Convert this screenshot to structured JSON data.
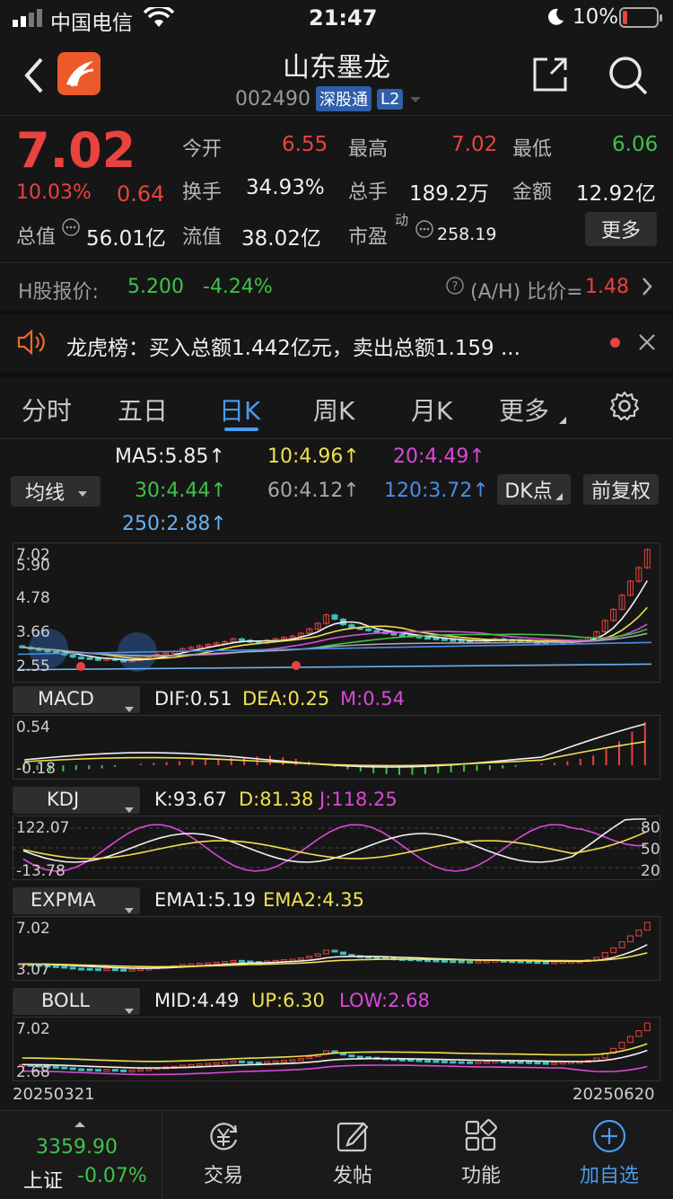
{
  "status_bar": {
    "carrier": "中国电信",
    "time": "21:47",
    "battery": "10%"
  },
  "header": {
    "title": "山东墨龙",
    "code": "002490",
    "badge_market": "深股通",
    "badge_level": "L2"
  },
  "quote": {
    "price": "7.02",
    "change_pct": "10.03%",
    "change": "0.64",
    "open_label": "今开",
    "open": "6.55",
    "high_label": "最高",
    "high": "7.02",
    "low_label": "最低",
    "low": "6.06",
    "turnover_label": "换手",
    "turnover": "34.93%",
    "volume_label": "总手",
    "volume": "189.2万",
    "amount_label": "金额",
    "amount": "12.92亿",
    "mktcap_label": "总值",
    "mktcap": "56.01亿",
    "float_label": "流值",
    "float": "38.02亿",
    "pe_label": "市盈",
    "pe_sup": "动",
    "pe": "258.19",
    "more_button": "更多"
  },
  "hshare": {
    "label": "H股报价:",
    "price": "5.200",
    "change_pct": "-4.24%",
    "ah_label": "(A/H) 比价=",
    "ah_value": "1.48"
  },
  "notice": {
    "text": "龙虎榜：买入总额1.442亿元，卖出总额1.159 ..."
  },
  "tabs": [
    {
      "label": "分时"
    },
    {
      "label": "五日"
    },
    {
      "label": "日K"
    },
    {
      "label": "周K"
    },
    {
      "label": "月K"
    },
    {
      "label": "更多"
    }
  ],
  "ma": {
    "selector": "均线",
    "ma5": "MA5:5.85",
    "ma10": "10:4.96",
    "ma20": "20:4.49",
    "ma30": "30:4.44",
    "ma60": "60:4.12",
    "ma120": "120:3.72",
    "ma250": "250:2.88",
    "dk_button": "DK点",
    "fq_button": "前复权",
    "arrow": "↑"
  },
  "colors": {
    "up": "#e8433f",
    "down": "#3fc24a",
    "accent": "#3b8fe8",
    "yellow": "#f0e050",
    "magenta": "#d84ad8"
  },
  "chart_data": [
    {
      "type": "candlestick",
      "panel": "main",
      "ylim": [
        2.55,
        7.02
      ],
      "y_tick_labels": [
        "7.02",
        "5.90",
        "4.78",
        "3.66",
        "2.55"
      ],
      "x_start": "20250321",
      "x_end": "20250620",
      "closes": [
        3.55,
        3.5,
        3.45,
        3.4,
        3.35,
        3.28,
        3.2,
        3.18,
        3.15,
        3.1,
        3.15,
        3.1,
        3.05,
        3.1,
        3.15,
        3.2,
        3.3,
        3.35,
        3.4,
        3.5,
        3.55,
        3.6,
        3.65,
        3.7,
        3.75,
        3.85,
        3.8,
        3.75,
        3.7,
        3.8,
        3.85,
        3.9,
        3.95,
        4.05,
        4.2,
        4.4,
        4.7,
        4.55,
        4.35,
        4.25,
        4.2,
        4.15,
        4.1,
        4.05,
        4.0,
        3.98,
        3.95,
        3.9,
        3.88,
        3.85,
        3.82,
        3.8,
        3.78,
        3.75,
        3.78,
        3.8,
        3.85,
        3.82,
        3.8,
        3.78,
        3.75,
        3.72,
        3.7,
        3.72,
        3.75,
        3.78,
        3.8,
        3.9,
        4.1,
        4.5,
        4.9,
        5.4,
        5.9,
        6.38,
        7.02
      ],
      "series": [
        {
          "name": "MA5",
          "value_label": "5.85"
        },
        {
          "name": "MA10",
          "value_label": "4.96"
        },
        {
          "name": "MA20",
          "value_label": "4.49"
        },
        {
          "name": "MA30",
          "value_label": "4.44"
        },
        {
          "name": "MA60",
          "value_label": "4.12"
        },
        {
          "name": "MA120",
          "value_label": "3.72"
        },
        {
          "name": "MA250",
          "value_label": "2.88"
        }
      ]
    },
    {
      "type": "bar",
      "panel": "MACD",
      "y_tick_labels": [
        "0.54",
        "-0.18"
      ],
      "values": [
        -0.05,
        -0.06,
        -0.07,
        -0.08,
        -0.06,
        -0.05,
        -0.04,
        -0.02,
        0.0,
        0.02,
        0.03,
        0.04,
        0.05,
        0.06,
        0.07,
        0.08,
        0.09,
        0.1,
        0.11,
        0.12,
        0.1,
        0.08,
        0.05,
        0.02,
        -0.02,
        -0.05,
        -0.08,
        -0.1,
        -0.11,
        -0.12,
        -0.12,
        -0.11,
        -0.1,
        -0.09,
        -0.08,
        -0.07,
        -0.06,
        -0.04,
        -0.02,
        0.0,
        0.02,
        0.03,
        0.05,
        0.08,
        0.12,
        0.2,
        0.3,
        0.42,
        0.54
      ],
      "labels": {
        "dif": "DIF:0.51",
        "dea": "DEA:0.25",
        "m": "M:0.54"
      }
    },
    {
      "type": "line",
      "panel": "KDJ",
      "y_tick_labels": [
        "122.07",
        "-13.78"
      ],
      "right_tick_labels": [
        "80",
        "50",
        "20"
      ],
      "labels": {
        "k": "K:93.67",
        "d": "D:81.38",
        "j": "J:118.25"
      }
    },
    {
      "type": "line",
      "panel": "EXPMA",
      "y_tick_labels": [
        "7.02",
        "3.07"
      ],
      "labels": {
        "ema1": "EMA1:5.19",
        "ema2": "EMA2:4.35"
      }
    },
    {
      "type": "line",
      "panel": "BOLL",
      "y_tick_labels": [
        "7.02",
        "2.68"
      ],
      "labels": {
        "mid": "MID:4.49",
        "up": "UP:6.30",
        "low": "LOW:2.68"
      }
    }
  ],
  "x_axis": {
    "start": "20250321",
    "end": "20250620"
  },
  "bottom_nav": {
    "index_value": "3359.90",
    "index_name": "上证",
    "index_change": "-0.07%",
    "items": [
      {
        "label": "交易"
      },
      {
        "label": "发帖"
      },
      {
        "label": "功能"
      },
      {
        "label": "加自选"
      }
    ]
  }
}
